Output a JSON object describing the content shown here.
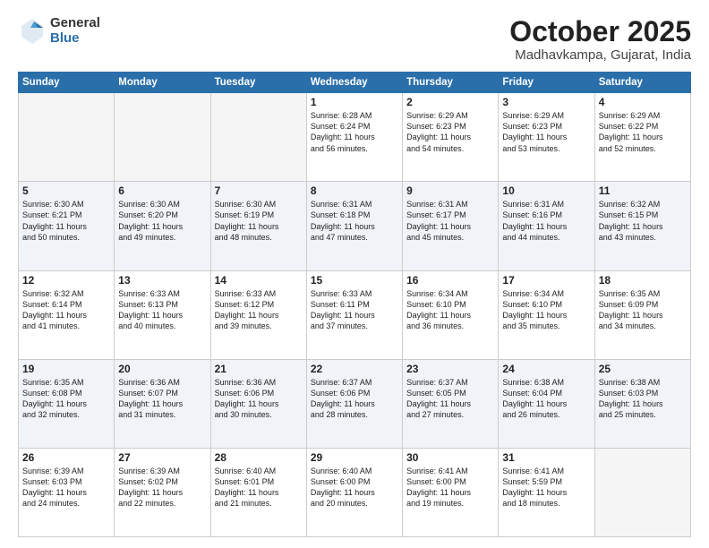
{
  "header": {
    "logo_general": "General",
    "logo_blue": "Blue",
    "month_title": "October 2025",
    "location": "Madhavkampa, Gujarat, India"
  },
  "weekdays": [
    "Sunday",
    "Monday",
    "Tuesday",
    "Wednesday",
    "Thursday",
    "Friday",
    "Saturday"
  ],
  "weeks": [
    [
      {
        "day": "",
        "info": ""
      },
      {
        "day": "",
        "info": ""
      },
      {
        "day": "",
        "info": ""
      },
      {
        "day": "1",
        "info": "Sunrise: 6:28 AM\nSunset: 6:24 PM\nDaylight: 11 hours\nand 56 minutes."
      },
      {
        "day": "2",
        "info": "Sunrise: 6:29 AM\nSunset: 6:23 PM\nDaylight: 11 hours\nand 54 minutes."
      },
      {
        "day": "3",
        "info": "Sunrise: 6:29 AM\nSunset: 6:23 PM\nDaylight: 11 hours\nand 53 minutes."
      },
      {
        "day": "4",
        "info": "Sunrise: 6:29 AM\nSunset: 6:22 PM\nDaylight: 11 hours\nand 52 minutes."
      }
    ],
    [
      {
        "day": "5",
        "info": "Sunrise: 6:30 AM\nSunset: 6:21 PM\nDaylight: 11 hours\nand 50 minutes."
      },
      {
        "day": "6",
        "info": "Sunrise: 6:30 AM\nSunset: 6:20 PM\nDaylight: 11 hours\nand 49 minutes."
      },
      {
        "day": "7",
        "info": "Sunrise: 6:30 AM\nSunset: 6:19 PM\nDaylight: 11 hours\nand 48 minutes."
      },
      {
        "day": "8",
        "info": "Sunrise: 6:31 AM\nSunset: 6:18 PM\nDaylight: 11 hours\nand 47 minutes."
      },
      {
        "day": "9",
        "info": "Sunrise: 6:31 AM\nSunset: 6:17 PM\nDaylight: 11 hours\nand 45 minutes."
      },
      {
        "day": "10",
        "info": "Sunrise: 6:31 AM\nSunset: 6:16 PM\nDaylight: 11 hours\nand 44 minutes."
      },
      {
        "day": "11",
        "info": "Sunrise: 6:32 AM\nSunset: 6:15 PM\nDaylight: 11 hours\nand 43 minutes."
      }
    ],
    [
      {
        "day": "12",
        "info": "Sunrise: 6:32 AM\nSunset: 6:14 PM\nDaylight: 11 hours\nand 41 minutes."
      },
      {
        "day": "13",
        "info": "Sunrise: 6:33 AM\nSunset: 6:13 PM\nDaylight: 11 hours\nand 40 minutes."
      },
      {
        "day": "14",
        "info": "Sunrise: 6:33 AM\nSunset: 6:12 PM\nDaylight: 11 hours\nand 39 minutes."
      },
      {
        "day": "15",
        "info": "Sunrise: 6:33 AM\nSunset: 6:11 PM\nDaylight: 11 hours\nand 37 minutes."
      },
      {
        "day": "16",
        "info": "Sunrise: 6:34 AM\nSunset: 6:10 PM\nDaylight: 11 hours\nand 36 minutes."
      },
      {
        "day": "17",
        "info": "Sunrise: 6:34 AM\nSunset: 6:10 PM\nDaylight: 11 hours\nand 35 minutes."
      },
      {
        "day": "18",
        "info": "Sunrise: 6:35 AM\nSunset: 6:09 PM\nDaylight: 11 hours\nand 34 minutes."
      }
    ],
    [
      {
        "day": "19",
        "info": "Sunrise: 6:35 AM\nSunset: 6:08 PM\nDaylight: 11 hours\nand 32 minutes."
      },
      {
        "day": "20",
        "info": "Sunrise: 6:36 AM\nSunset: 6:07 PM\nDaylight: 11 hours\nand 31 minutes."
      },
      {
        "day": "21",
        "info": "Sunrise: 6:36 AM\nSunset: 6:06 PM\nDaylight: 11 hours\nand 30 minutes."
      },
      {
        "day": "22",
        "info": "Sunrise: 6:37 AM\nSunset: 6:06 PM\nDaylight: 11 hours\nand 28 minutes."
      },
      {
        "day": "23",
        "info": "Sunrise: 6:37 AM\nSunset: 6:05 PM\nDaylight: 11 hours\nand 27 minutes."
      },
      {
        "day": "24",
        "info": "Sunrise: 6:38 AM\nSunset: 6:04 PM\nDaylight: 11 hours\nand 26 minutes."
      },
      {
        "day": "25",
        "info": "Sunrise: 6:38 AM\nSunset: 6:03 PM\nDaylight: 11 hours\nand 25 minutes."
      }
    ],
    [
      {
        "day": "26",
        "info": "Sunrise: 6:39 AM\nSunset: 6:03 PM\nDaylight: 11 hours\nand 24 minutes."
      },
      {
        "day": "27",
        "info": "Sunrise: 6:39 AM\nSunset: 6:02 PM\nDaylight: 11 hours\nand 22 minutes."
      },
      {
        "day": "28",
        "info": "Sunrise: 6:40 AM\nSunset: 6:01 PM\nDaylight: 11 hours\nand 21 minutes."
      },
      {
        "day": "29",
        "info": "Sunrise: 6:40 AM\nSunset: 6:00 PM\nDaylight: 11 hours\nand 20 minutes."
      },
      {
        "day": "30",
        "info": "Sunrise: 6:41 AM\nSunset: 6:00 PM\nDaylight: 11 hours\nand 19 minutes."
      },
      {
        "day": "31",
        "info": "Sunrise: 6:41 AM\nSunset: 5:59 PM\nDaylight: 11 hours\nand 18 minutes."
      },
      {
        "day": "",
        "info": ""
      }
    ]
  ]
}
